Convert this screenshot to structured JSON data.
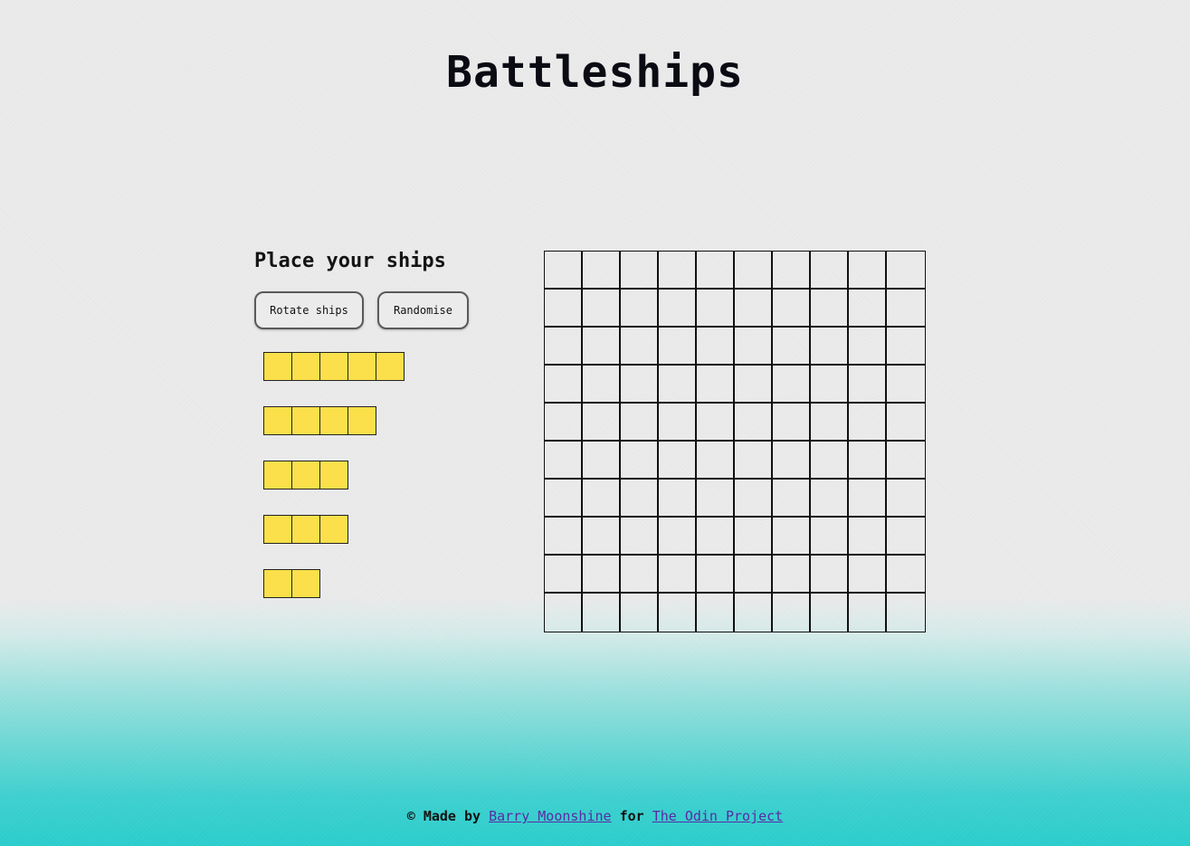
{
  "header": {
    "title": "Battleships"
  },
  "placement": {
    "title": "Place your ships",
    "rotate_label": "Rotate ships",
    "randomise_label": "Randomise",
    "ship_color": "#fbe04b",
    "ships": [
      {
        "name": "ship-5",
        "length": 5
      },
      {
        "name": "ship-4",
        "length": 4
      },
      {
        "name": "ship-3a",
        "length": 3
      },
      {
        "name": "ship-3b",
        "length": 3
      },
      {
        "name": "ship-2",
        "length": 2
      }
    ]
  },
  "board": {
    "rows": 10,
    "cols": 10
  },
  "footer": {
    "prefix": "© Made by",
    "author_link": "Barry Moonshine",
    "middle": "for",
    "project_link": "The Odin Project",
    "link_color": "#5b2aa3"
  },
  "colors": {
    "background": "#ebebeb",
    "gradient_bottom": "#2ccfce",
    "text": "#0b0b14"
  }
}
